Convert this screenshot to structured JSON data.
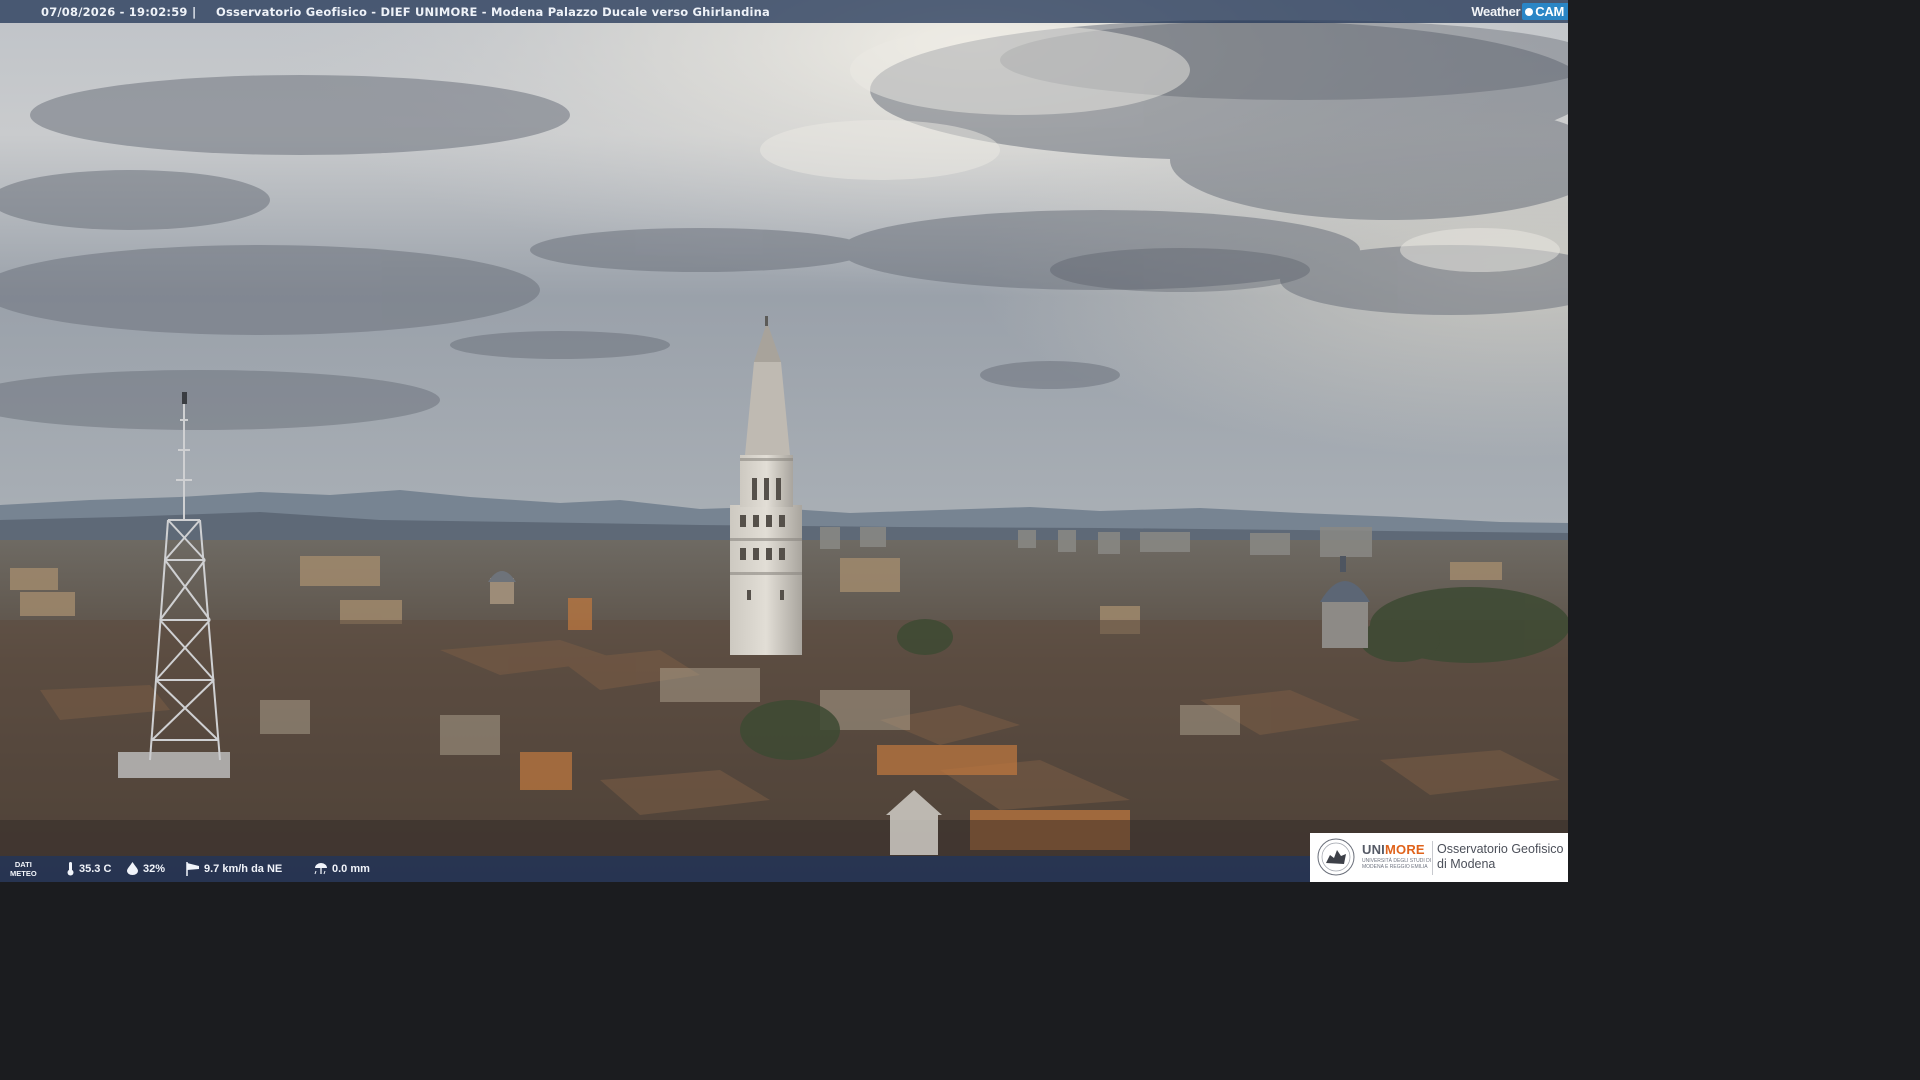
{
  "header": {
    "timestamp": "07/08/2026 - 19:02:59",
    "separator": "|",
    "title": "Osservatorio Geofisico - DIEF UNIMORE - Modena Palazzo Ducale verso Ghirlandina",
    "brand_weather": "Weather",
    "brand_cam": "CAM"
  },
  "meteo": {
    "label_line1": "DATI",
    "label_line2": "METEO",
    "temperature": "35.3 C",
    "humidity": "32%",
    "wind": "9.7 km/h da NE",
    "rain": "0.0 mm",
    "icons": [
      "thermometer-icon",
      "humidity-drop-icon",
      "wind-sock-icon",
      "rain-umbrella-icon"
    ]
  },
  "logo": {
    "uni_part1": "UNI",
    "uni_part2": "MORE",
    "uni_sub": "UNIVERSITÀ DEGLI STUDI DI MODENA E REGGIO EMILIA",
    "observatory_line1": "Osservatorio Geofisico",
    "observatory_line2": "di Modena"
  },
  "colors": {
    "top_bar": "#263a5a",
    "meteo_bar": "#1e345f",
    "brand_blue": "#2a86c6",
    "unimore_orange": "#e0631b"
  }
}
